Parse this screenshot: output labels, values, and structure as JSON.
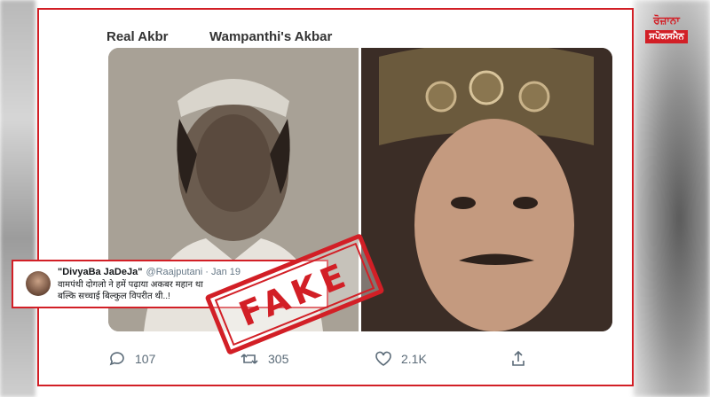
{
  "tweet": {
    "labels": {
      "left": "Real Akbr",
      "right": "Wampanthi's Akbar"
    },
    "actions": {
      "replies": "107",
      "retweets": "305",
      "likes": "2.1K"
    }
  },
  "embedded_tweet": {
    "name": "\"DivyaBa JaDeJa\"",
    "handle": "@Raajputani · Jan 19",
    "line1": "वामपंथी दोगलो ने हमें पढ़ाया अकबर महान था",
    "line2": "बल्कि सच्चाई बिल्कुल विपरीत थी..!"
  },
  "stamp": {
    "text": "FAKE"
  },
  "logo": {
    "line1": "ਰੋਜ਼ਾਨਾ",
    "line2": "ਸਪੋਕਸਮੈਨ"
  },
  "colors": {
    "accent_red": "#d21f26",
    "icon_gray": "#5b6b78"
  }
}
